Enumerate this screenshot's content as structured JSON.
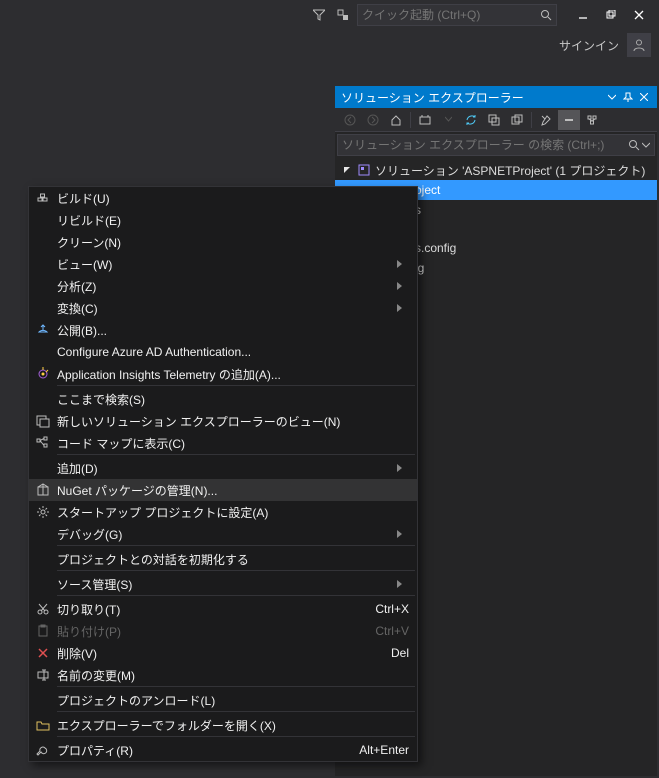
{
  "titleBar": {
    "quickLaunchPlaceholder": "クイック起動 (Ctrl+Q)",
    "signIn": "サインイン"
  },
  "solutionExplorer": {
    "title": "ソリューション エクスプローラー",
    "searchPlaceholder": "ソリューション エクスプローラー の検索 (Ctrl+;)",
    "solutionLine": "ソリューション 'ASPNETProject' (1 プロジェクト)",
    "selectedProjectFragment": "oject",
    "items": [
      "s",
      "s.config",
      "ig"
    ]
  },
  "contextMenu": {
    "items": [
      {
        "type": "item",
        "icon": "build",
        "label": "ビルド(U)"
      },
      {
        "type": "item",
        "icon": "",
        "label": "リビルド(E)"
      },
      {
        "type": "item",
        "icon": "",
        "label": "クリーン(N)"
      },
      {
        "type": "item",
        "icon": "",
        "label": "ビュー(W)",
        "submenu": true
      },
      {
        "type": "item",
        "icon": "",
        "label": "分析(Z)",
        "submenu": true
      },
      {
        "type": "item",
        "icon": "",
        "label": "変換(C)",
        "submenu": true
      },
      {
        "type": "item",
        "icon": "publish",
        "label": "公開(B)..."
      },
      {
        "type": "item",
        "icon": "",
        "label": "Configure Azure AD Authentication..."
      },
      {
        "type": "item",
        "icon": "appinsights",
        "label": "Application Insights Telemetry の追加(A)..."
      },
      {
        "type": "sep"
      },
      {
        "type": "item",
        "icon": "",
        "label": "ここまで検索(S)"
      },
      {
        "type": "item",
        "icon": "newview",
        "label": "新しいソリューション エクスプローラーのビュー(N)"
      },
      {
        "type": "item",
        "icon": "codemap",
        "label": "コード マップに表示(C)"
      },
      {
        "type": "sep"
      },
      {
        "type": "item",
        "icon": "",
        "label": "追加(D)",
        "submenu": true
      },
      {
        "type": "item",
        "icon": "nuget",
        "label": "NuGet パッケージの管理(N)...",
        "highlight": true
      },
      {
        "type": "item",
        "icon": "gear",
        "label": "スタートアップ プロジェクトに設定(A)"
      },
      {
        "type": "item",
        "icon": "",
        "label": "デバッグ(G)",
        "submenu": true
      },
      {
        "type": "sep"
      },
      {
        "type": "item",
        "icon": "",
        "label": "プロジェクトとの対話を初期化する"
      },
      {
        "type": "sep"
      },
      {
        "type": "item",
        "icon": "",
        "label": "ソース管理(S)",
        "submenu": true
      },
      {
        "type": "sep"
      },
      {
        "type": "item",
        "icon": "cut",
        "label": "切り取り(T)",
        "shortcut": "Ctrl+X"
      },
      {
        "type": "item",
        "icon": "paste",
        "label": "貼り付け(P)",
        "shortcut": "Ctrl+V",
        "disabled": true
      },
      {
        "type": "item",
        "icon": "delete",
        "label": "削除(V)",
        "shortcut": "Del"
      },
      {
        "type": "item",
        "icon": "rename",
        "label": "名前の変更(M)"
      },
      {
        "type": "sep"
      },
      {
        "type": "item",
        "icon": "",
        "label": "プロジェクトのアンロード(L)"
      },
      {
        "type": "sep"
      },
      {
        "type": "item",
        "icon": "folder",
        "label": "エクスプローラーでフォルダーを開く(X)"
      },
      {
        "type": "sep"
      },
      {
        "type": "item",
        "icon": "wrench",
        "label": "プロパティ(R)",
        "shortcut": "Alt+Enter"
      }
    ]
  }
}
